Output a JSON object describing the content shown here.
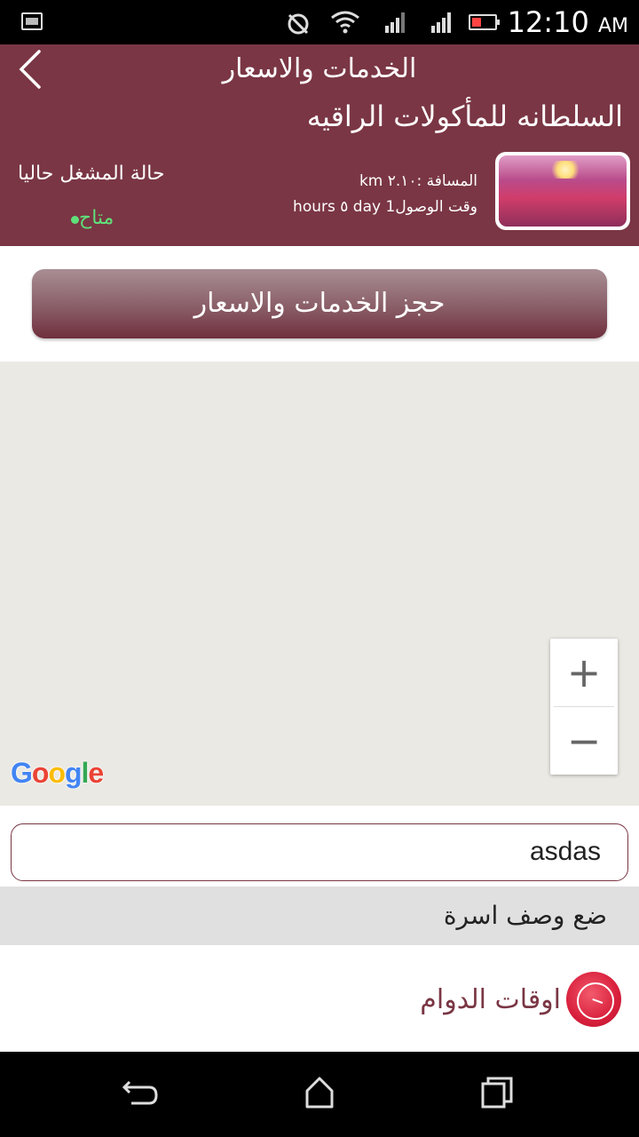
{
  "status_bar": {
    "time": "12:10",
    "ampm": "AM",
    "icons": [
      "notification-icon",
      "sync-icon",
      "wifi-icon",
      "signal-1-icon",
      "signal-2-icon",
      "battery-icon"
    ]
  },
  "header": {
    "title": "الخدمات والاسعار",
    "shop_name": "السلطانه للمأكولات الراقيه",
    "distance": "المسافة :٢.١٠ km",
    "eta": "وقت الوصول1 day ٥ hours",
    "operator_status_label": "حالة المشغل حاليا",
    "availability": "متاح",
    "colors": {
      "primary": "#7a3644",
      "available": "#5fe07a"
    }
  },
  "book_button": {
    "label": "حجز الخدمات والاسعار"
  },
  "map": {
    "zoom_in": "+",
    "zoom_out": "−",
    "logo": [
      "G",
      "o",
      "o",
      "g",
      "l",
      "e"
    ],
    "logo_colors": [
      "#4285F4",
      "#EA4335",
      "#FBBC05",
      "#4285F4",
      "#34A853",
      "#EA4335"
    ]
  },
  "text_field": {
    "value": "asdas"
  },
  "description_bar": {
    "label": "ضع وصف اسرة"
  },
  "working_hours": {
    "label": "اوقات الدوام",
    "icon": "clock-icon"
  },
  "nav_bar": {
    "items": [
      "back-icon",
      "home-icon",
      "recents-icon"
    ]
  }
}
